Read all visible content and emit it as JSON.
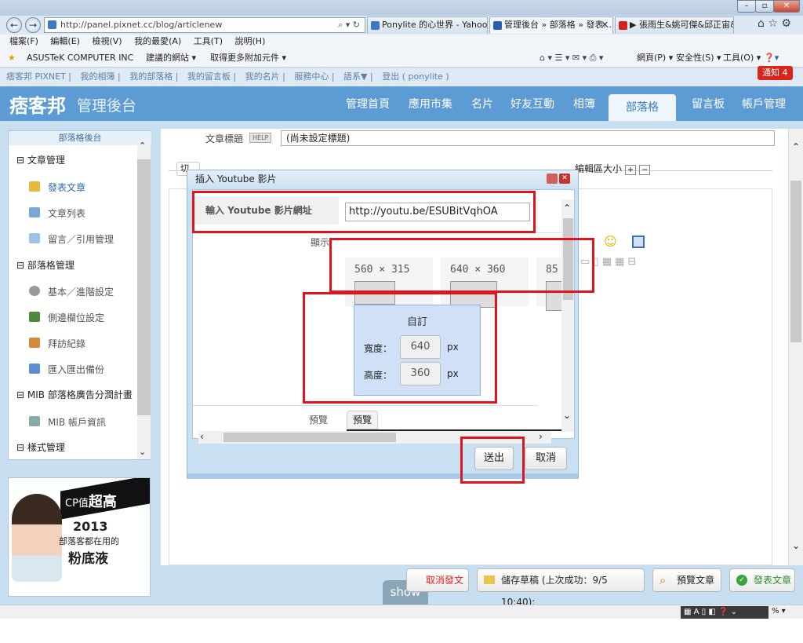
{
  "browser": {
    "address": "http://panel.pixnet.cc/blog/articlenew",
    "tabs": [
      {
        "label": "Ponylite 的心世界 - Yahoo!..."
      },
      {
        "label": "管理後台 » 部落格 » 發表..."
      },
      {
        "label": "▶ 張雨生&姚可傑&邱正宙&..."
      }
    ],
    "tab_close": "✕",
    "menu": [
      "檔案(F)",
      "編輯(E)",
      "檢視(V)",
      "我的最愛(A)",
      "工具(T)",
      "說明(H)"
    ],
    "favorites": [
      "ASUSTeK COMPUTER INC",
      "建議的網站 ▾",
      "取得更多附加元件 ▾"
    ],
    "commandbar": [
      "網頁(P) ▾",
      "安全性(S) ▾",
      "工具(O) ▾"
    ]
  },
  "pix": {
    "top_links": [
      "痞客邦 PIXNET",
      "我的相簿",
      "我的部落格",
      "我的留言板",
      "我的名片",
      "服務中心",
      "語系▼",
      "登出 ( ponylite )"
    ],
    "notice": "通知 4",
    "logo": "痞客邦",
    "logo_sub": "管理後台",
    "nav": [
      "管理首頁",
      "應用市集",
      "名片",
      "好友互動",
      "相簿",
      "部落格",
      "留言板",
      "帳戶管理"
    ]
  },
  "sidebar": {
    "head": "部落格後台",
    "sections": [
      {
        "title": "文章管理",
        "items": [
          "發表文章",
          "文章列表",
          "留言／引用管理"
        ]
      },
      {
        "title": "部落格管理",
        "items": [
          "基本／進階設定",
          "側邊欄位設定",
          "拜訪紀錄",
          "匯入匯出備份"
        ]
      },
      {
        "title": "MIB 部落格廣告分潤計畫",
        "items": [
          "MIB 帳戶資訊"
        ]
      },
      {
        "title": "樣式管理",
        "items": []
      }
    ]
  },
  "ad": {
    "line1": "CP值",
    "line1b": "超高",
    "year": "2013",
    "line2": "部落客都在用的",
    "line3": "粉底液"
  },
  "editor": {
    "title_label": "文章標題",
    "help": "HELP",
    "title_value": "(尚未設定標題)",
    "toolbar_partial": "切",
    "toolbar_right": "編輯區大小",
    "plus": "+",
    "minus": "−"
  },
  "dialog": {
    "title": "插入 Youtube 影片",
    "url_label": "輸入 Youtube 影片網址",
    "url_value": "http://youtu.be/ESUBitVqhOA",
    "display_label": "顯示",
    "presets": [
      "560 × 315",
      "640 × 360",
      "85"
    ],
    "custom_title": "自訂",
    "width_label": "寬度：",
    "width_value": "640",
    "height_label": "高度：",
    "height_value": "360",
    "unit": "px",
    "preview_label": "預覽",
    "preview_button": "預覽",
    "submit": "送出",
    "cancel": "取消"
  },
  "bottom": {
    "cancel_post": "取消發文",
    "save_draft": "儲存草稿 (上次成功：9/5 10:40):",
    "preview_post": "預覽文章",
    "publish": "發表文章",
    "show": "show"
  }
}
